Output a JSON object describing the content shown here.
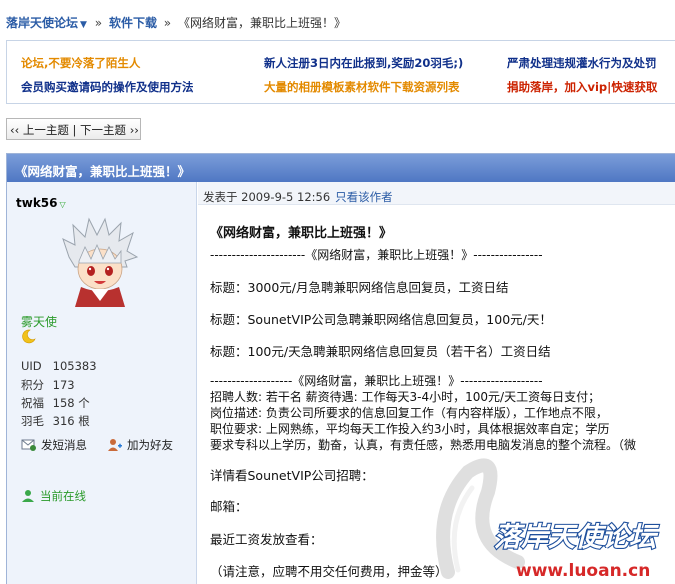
{
  "breadcrumb": {
    "forum": "落岸天使论坛",
    "section": "软件下载",
    "separator": "»",
    "current": "《网络财富，兼职比上班强！》"
  },
  "announcements": [
    {
      "text": "论坛,不要冷落了陌生人",
      "color": "orange"
    },
    {
      "text": "新人注册3日内在此报到,奖励20羽毛;)",
      "color": "navy"
    },
    {
      "text": "严肃处理违规灌水行为及处罚",
      "color": "navy"
    },
    {
      "text": "会员购买邀请码的操作及使用方法",
      "color": "navy"
    },
    {
      "text": "大量的相册模板素材软件下载资源列表",
      "color": "orange"
    },
    {
      "text": "捐助落岸，加入vip|快速获取",
      "color": "red"
    }
  ],
  "thread_nav": {
    "prev": "‹‹ 上一主题",
    "divider": "|",
    "next": "下一主题 ››"
  },
  "post": {
    "title": "《网络财富，兼职比上班强！》",
    "author": "twk56",
    "user_title": "雾天使",
    "stats": [
      {
        "label": "UID",
        "value": "105383"
      },
      {
        "label": "积分",
        "value": "173"
      },
      {
        "label": "祝福",
        "value": "158 个"
      },
      {
        "label": "羽毛",
        "value": "316 根"
      }
    ],
    "actions": {
      "message": "发短消息",
      "add_friend": "加为好友",
      "online": "当前在线"
    },
    "meta": {
      "posted": "发表于 2009-9-5 12:56",
      "only_author": "只看该作者"
    },
    "body": {
      "heading": "《网络财富，兼职比上班强！》",
      "divider1": "----------------------《网络财富，兼职比上班强！》----------------",
      "t1": "标题：3000元/月急聘兼职网络信息回复员，工资日结",
      "t2": "标题：SounetVIP公司急聘兼职网络信息回复员，100元/天！",
      "t3": "标题：100元/天急聘兼职网络信息回复员（若干名）工资日结",
      "divider2": "-------------------《网络财富，兼职比上班强！》-------------------",
      "d1": "招聘人数: 若干名    薪资待遇: 工作每天3-4小时，100元/天工资每日支付；",
      "d2": "岗位描述: 负责公司所要求的信息回复工作（有内容样版），工作地点不限，",
      "d3": "职位要求: 上网熟练，平均每天工作投入约3小时，具体根据效率自定；学历",
      "d4": "要求专科以上学历，勤奋，认真，有责任感，熟悉用电脑发消息的整个流程。（微",
      "details": "详情看SounetVIP公司招聘：",
      "email": "邮箱：",
      "recent": "最近工资发放查看：",
      "note": "（请注意，应聘不用交任何费用，押金等）"
    }
  },
  "watermark": {
    "cn": "落岸天使论坛",
    "url": "www.luoan.cn"
  }
}
